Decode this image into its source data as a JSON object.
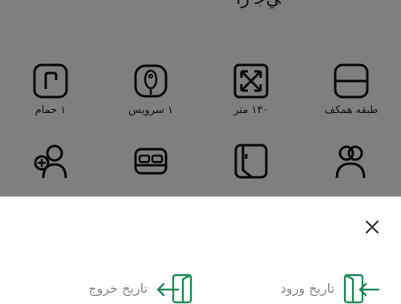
{
  "background": {
    "title": "ﻲﺟ ﺭﺍ",
    "features": [
      {
        "label": "طبقه همکف",
        "icon": "floor-icon"
      },
      {
        "label": "۱۳۰ متر",
        "icon": "area-expand-icon"
      },
      {
        "label": "۱ سرویس",
        "icon": "toilet-icon"
      },
      {
        "label": "۱ حمام",
        "icon": "shower-icon"
      },
      {
        "label": "",
        "icon": "users-icon"
      },
      {
        "label": "",
        "icon": "door-icon"
      },
      {
        "label": "",
        "icon": "bed-icon"
      },
      {
        "label": "",
        "icon": "add-user-icon"
      }
    ]
  },
  "sheet": {
    "close_icon": "close-icon",
    "checkin_label": "تاریخ ورود",
    "checkout_label": "تاریخ خروج",
    "accent_color": "#1f8a5b"
  }
}
